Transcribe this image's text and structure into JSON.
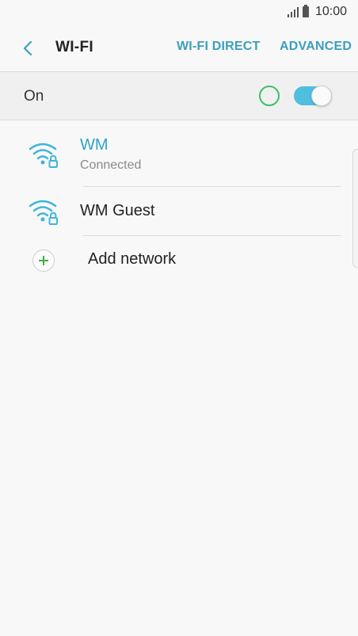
{
  "status_bar": {
    "time": "10:00"
  },
  "app_bar": {
    "back_icon": "back-arrow-icon",
    "title": "WI-FI",
    "wifi_direct_label": "WI-FI DIRECT",
    "advanced_label": "ADVANCED"
  },
  "master_switch": {
    "label": "On",
    "state": "on"
  },
  "networks": [
    {
      "name": "WM",
      "status": "Connected",
      "secured": true,
      "connected": true
    },
    {
      "name": "WM Guest",
      "secured": true,
      "connected": false
    }
  ],
  "add_network": {
    "label": "Add network",
    "icon": "plus-icon"
  },
  "colors": {
    "accent": "#3a9fbf",
    "connected_name": "#2ea3c7",
    "toggle_on": "#4fbfe0",
    "add_plus": "#3cb043",
    "ring": "#3cc06a"
  }
}
